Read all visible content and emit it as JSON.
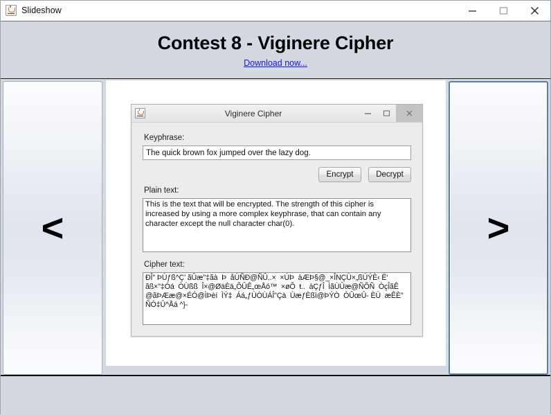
{
  "window": {
    "title": "Slideshow",
    "app_icon": "java-coffee-cup-icon",
    "controls": {
      "minimize": "minimize-icon",
      "maximize": "maximize-icon",
      "close": "close-icon"
    }
  },
  "banner": {
    "heading": "Contest 8 - Viginere Cipher",
    "download_link": "Download now...",
    "link_color": "#1414ff"
  },
  "nav": {
    "prev_label": "<",
    "next_label": ">"
  },
  "dialog": {
    "app_icon": "java-coffee-cup-icon",
    "title": "Viginere Cipher",
    "controls": {
      "minimize": "minimize-icon",
      "maximize": "maximize-icon",
      "close": "close-icon"
    },
    "keyphrase_label": "Keyphrase:",
    "keyphrase_value": "The quick brown fox jumped over the lazy dog.",
    "keyphrase_placeholder": "",
    "encrypt_label": "Encrypt",
    "decrypt_label": "Decrypt",
    "plain_label": "Plain text:",
    "plain_value": "This is the text that will be encrypted. The strength of this cipher is increased by using a more complex keyphrase, that can contain any character except the null character char(0).",
    "cipher_label": "Cipher text:",
    "cipher_value": "ÐÎ\" ÞÙƒß^Ç’ ãÛæ\"‡ãà  Þ  åÙÑÐ@ÑÛ..×  ×ÚÞ  àÆÞ§@_×ÎNÇÙ×„ßÚÝÈ‹ Ë‘ ãß×\"‡Óá  ÒÙßß  Î×@ØäÈä„ÕÛÊ„œÅó™  ×øÕ  ŧ..  àÇƒÎ  ÌãÙÛæ@ÑÕÑ  ÒçÎãÊ @ãÞÆæ@×ÉÓ@ÌÞèí  ÌÝ‡  Áá„ƒÙÒÙÁÎ\"Çà  ÙæƒÈßì@ÞÝÒ  ÒÛœÛ- ÈÙ  æÊÈ\" ÑÓ‡Û^Åá ^}-"
  }
}
